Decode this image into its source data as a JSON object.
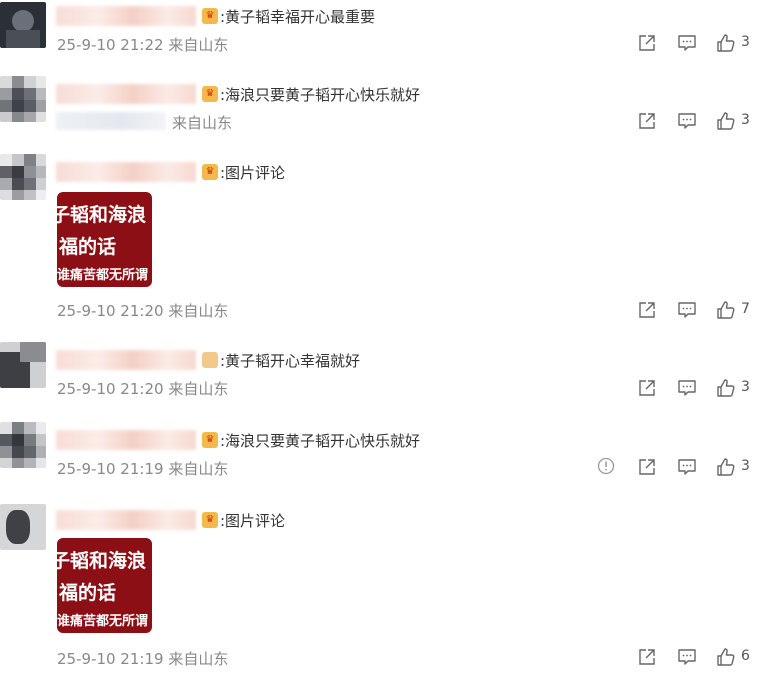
{
  "comments": [
    {
      "text": ":黄子韬幸福开心最重要",
      "time": "25-9-10 21:22",
      "location": "来自山东",
      "likes": "3",
      "has_image": false
    },
    {
      "text": ":海浪只要黄子韬开心快乐就好",
      "time": "",
      "location": "来自山东",
      "likes": "3",
      "has_image": false
    },
    {
      "text": ":图片评论",
      "time": "25-9-10 21:20",
      "location": "来自山东",
      "likes": "7",
      "has_image": true,
      "image_lines": [
        "子韬和海浪",
        "福的话",
        "谁痛苦都无所谓"
      ]
    },
    {
      "text": ":黄子韬开心幸福就好",
      "time": "25-9-10 21:20",
      "location": "来自山东",
      "likes": "3",
      "has_image": false
    },
    {
      "text": ":海浪只要黄子韬开心快乐就好",
      "time": "25-9-10 21:19",
      "location": "来自山东",
      "likes": "3",
      "has_image": false,
      "has_report": true
    },
    {
      "text": ":图片评论",
      "time": "25-9-10 21:19",
      "location": "来自山东",
      "likes": "6",
      "has_image": true,
      "image_lines": [
        "子韬和海浪",
        "福的话",
        "谁痛苦都无所谓"
      ]
    }
  ],
  "icons": {
    "share": "share-icon",
    "reply": "comment-icon",
    "like": "like-icon",
    "report": "report-icon"
  },
  "colors": {
    "meta_text": "#888888",
    "image_bg": "#8b0f14",
    "badge": "#f5b84a"
  }
}
